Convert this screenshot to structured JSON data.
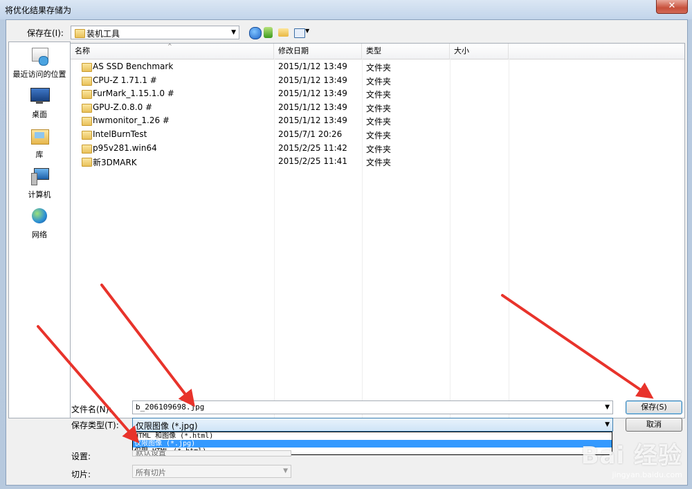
{
  "window": {
    "title": "将优化结果存储为",
    "close": "✕"
  },
  "save_in": {
    "label": "保存在(I):",
    "value": "装机工具"
  },
  "places": [
    {
      "icon": "recent-places-icon",
      "label": "最近访问的位置"
    },
    {
      "icon": "desktop-icon",
      "label": "桌面"
    },
    {
      "icon": "libraries-icon",
      "label": "库"
    },
    {
      "icon": "computer-icon",
      "label": "计算机"
    },
    {
      "icon": "network-icon",
      "label": "网络"
    }
  ],
  "columns": {
    "name": "名称",
    "date": "修改日期",
    "type": "类型",
    "size": "大小"
  },
  "files": [
    {
      "name": "AS SSD Benchmark",
      "date": "2015/1/12 13:49",
      "type": "文件夹"
    },
    {
      "name": "CPU-Z 1.71.1 #",
      "date": "2015/1/12 13:49",
      "type": "文件夹"
    },
    {
      "name": "FurMark_1.15.1.0 #",
      "date": "2015/1/12 13:49",
      "type": "文件夹"
    },
    {
      "name": "GPU-Z.0.8.0  #",
      "date": "2015/1/12 13:49",
      "type": "文件夹"
    },
    {
      "name": "hwmonitor_1.26  #",
      "date": "2015/1/12 13:49",
      "type": "文件夹"
    },
    {
      "name": "IntelBurnTest",
      "date": "2015/7/1 20:26",
      "type": "文件夹"
    },
    {
      "name": "p95v281.win64",
      "date": "2015/2/25 11:42",
      "type": "文件夹"
    },
    {
      "name": "新3DMARK",
      "date": "2015/2/25 11:41",
      "type": "文件夹"
    }
  ],
  "filename": {
    "label": "文件名(N):",
    "value": "b_206109698.jpg"
  },
  "savetype": {
    "label": "保存类型(T):",
    "value": "仅限图像 (*.jpg)",
    "options": [
      "HTML 和图像 (*.html)",
      "仅限图像 (*.jpg)",
      "仅限 HTML (*.html)"
    ]
  },
  "settings": {
    "label": "设置:",
    "value": "默认设置"
  },
  "slices": {
    "label": "切片:",
    "value": "所有切片"
  },
  "buttons": {
    "save": "保存(S)",
    "cancel": "取消"
  },
  "watermark": {
    "brand": "Bai 经验",
    "url": "jingyan.baidu.com"
  },
  "colors": {
    "annotation_arrow": "#e8332b",
    "selection": "#3399ff"
  }
}
